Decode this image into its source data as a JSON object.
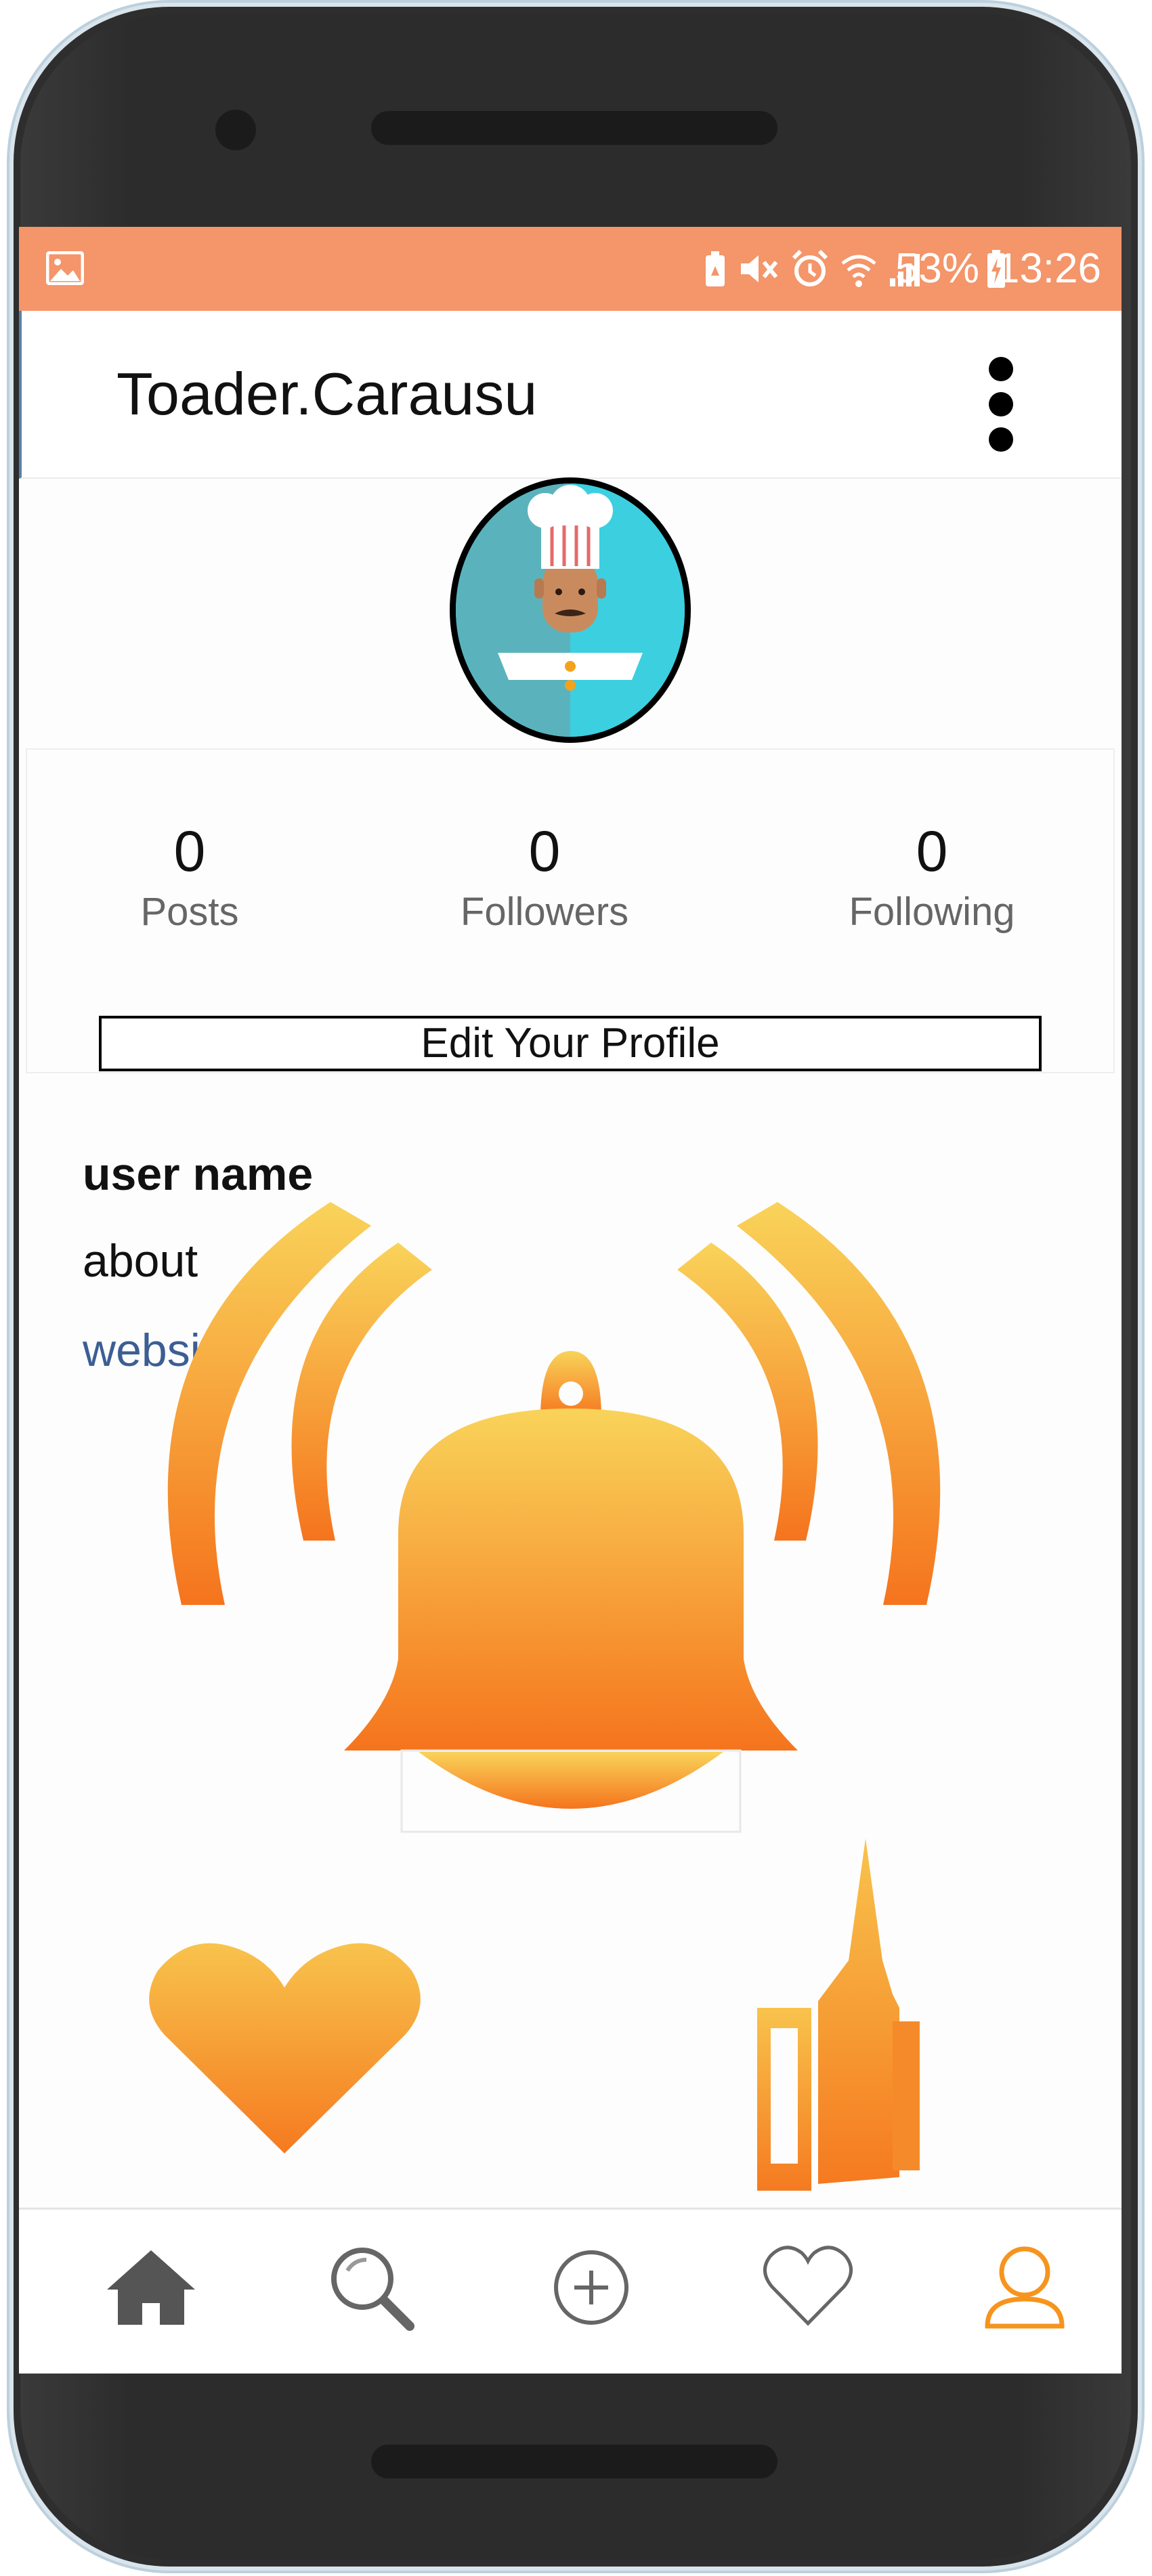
{
  "statusbar": {
    "battery": "53%",
    "time": "13:26",
    "icons": [
      "image-icon",
      "nfc-icon",
      "mute-icon",
      "alarm-icon",
      "wifi-icon",
      "signal-icon",
      "battery-charging-icon"
    ]
  },
  "toolbar": {
    "title": "Toader.Carausu",
    "menu_icon": "more-vert-icon"
  },
  "profile": {
    "avatar_icon": "chef-avatar",
    "stats": [
      {
        "value": "0",
        "label": "Posts"
      },
      {
        "value": "0",
        "label": "Followers"
      },
      {
        "value": "0",
        "label": "Following"
      }
    ],
    "edit_button": "Edit Your Profile",
    "user_name": "user name",
    "about": "about",
    "website": "website"
  },
  "overlay": {
    "icons": [
      "bell-ringing-icon",
      "heart-icon",
      "thumbs-up-icon"
    ],
    "gradient": [
      "#f9d35a",
      "#f5741d"
    ]
  },
  "nav": {
    "items": [
      {
        "icon": "home-icon",
        "active": false
      },
      {
        "icon": "search-icon",
        "active": false
      },
      {
        "icon": "add-circle-icon",
        "active": false
      },
      {
        "icon": "heart-outline-icon",
        "active": false
      },
      {
        "icon": "profile-icon",
        "active": true
      }
    ],
    "active_color": "#f7941d",
    "inactive_color": "#555555"
  }
}
